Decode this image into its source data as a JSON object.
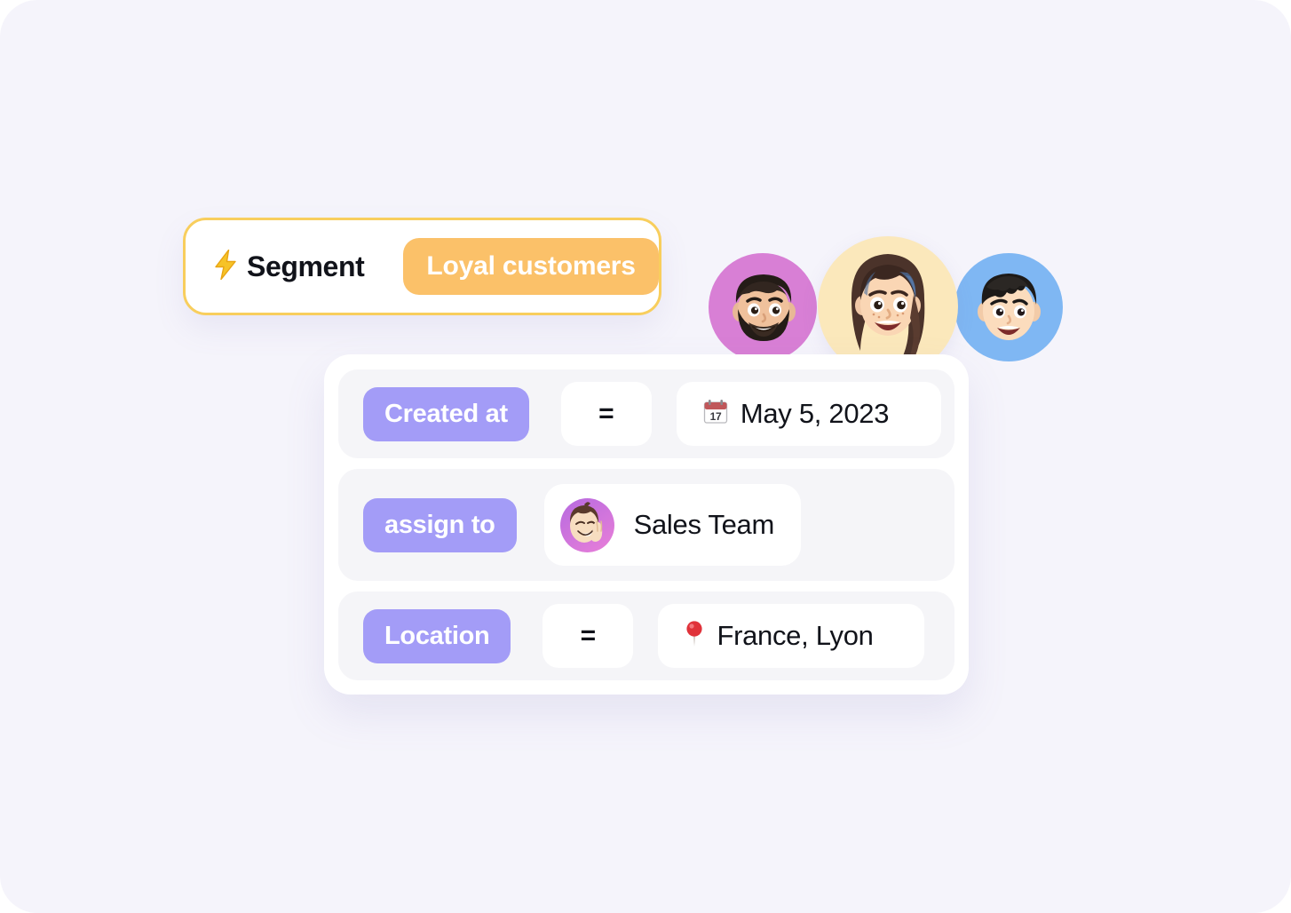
{
  "theme": {
    "page_background": "#f5f4fb",
    "card_background": "#ffffff",
    "row_background": "#f5f5f8",
    "field_chip_color": "#a39cf7",
    "segment_border_color": "#f8ce5d",
    "segment_value_color": "#fbc169",
    "text_color": "#11131a"
  },
  "segment": {
    "icon": "lightning-bolt-icon",
    "icon_glyph": "⚡",
    "label": "Segment",
    "value": "Loyal customers"
  },
  "avatars": [
    {
      "name": "avatar-bearded-man",
      "background": "#d87fd5",
      "size": 122
    },
    {
      "name": "avatar-woman",
      "background": "#fbe8bb",
      "size": 158
    },
    {
      "name": "avatar-young-man",
      "background": "#7fb7f3",
      "size": 122
    }
  ],
  "filters": [
    {
      "field": "Created at",
      "operator": "=",
      "value": "May 5, 2023",
      "value_icon": "calendar-icon",
      "value_icon_glyph": "📅"
    },
    {
      "field": "assign to",
      "operator": "",
      "value": "Sales Team",
      "value_icon": "assignee-avatar-icon",
      "value_icon_glyph": ""
    },
    {
      "field": "Location",
      "operator": "=",
      "value": "France, Lyon",
      "value_icon": "map-pin-icon",
      "value_icon_glyph": "📍"
    }
  ]
}
